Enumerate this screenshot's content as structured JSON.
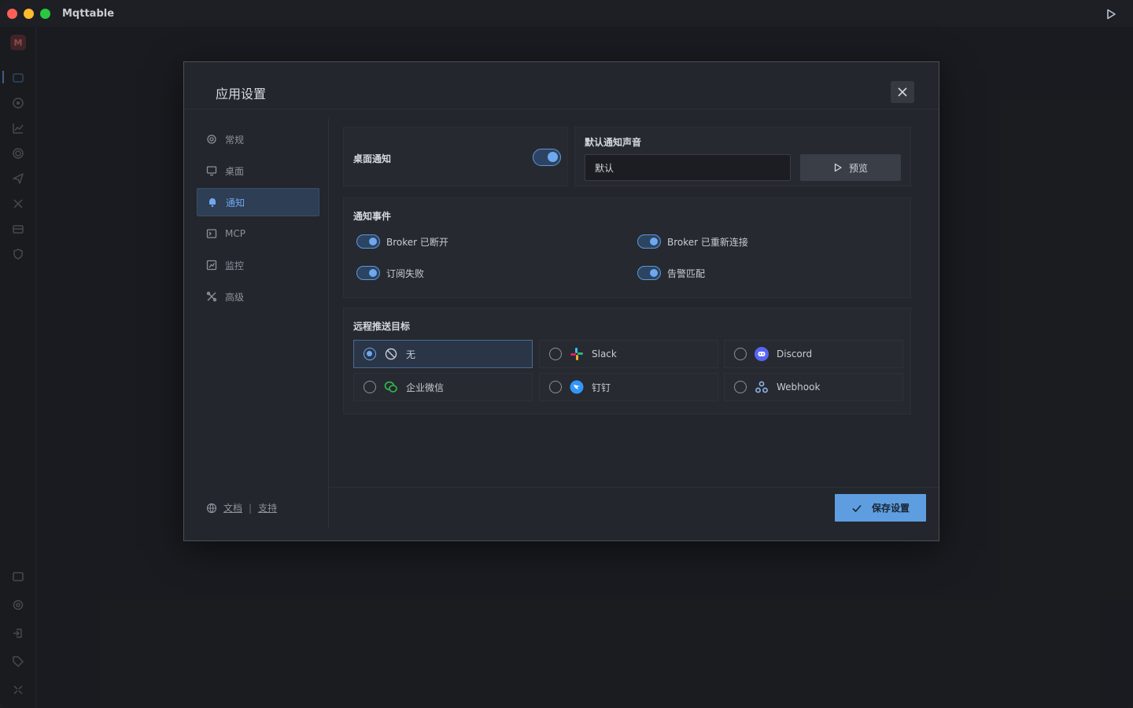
{
  "app": {
    "title": "Mqttable"
  },
  "dialog": {
    "title": "应用设置",
    "close_label": "close"
  },
  "sidebar": {
    "items": [
      {
        "label": "常规",
        "icon": "gear-icon"
      },
      {
        "label": "桌面",
        "icon": "monitor-icon"
      },
      {
        "label": "通知",
        "icon": "bell-icon",
        "active": true
      },
      {
        "label": "MCP",
        "icon": "terminal-icon"
      },
      {
        "label": "监控",
        "icon": "chart-icon"
      },
      {
        "label": "高级",
        "icon": "tools-icon"
      }
    ],
    "footer": {
      "docs": "文档",
      "separator": "|",
      "support": "支持"
    }
  },
  "desktop_notification": {
    "label": "桌面通知",
    "enabled": true
  },
  "sound": {
    "label": "默认通知声音",
    "value": "默认",
    "preview_label": "预览"
  },
  "events": {
    "title": "通知事件",
    "items": [
      {
        "label": "Broker 已断开",
        "enabled": true
      },
      {
        "label": "Broker 已重新连接",
        "enabled": true
      },
      {
        "label": "订阅失败",
        "enabled": true
      },
      {
        "label": "告警匹配",
        "enabled": true
      }
    ]
  },
  "targets": {
    "title": "远程推送目标",
    "items": [
      {
        "label": "无",
        "icon": "ban-icon",
        "selected": true
      },
      {
        "label": "Slack",
        "icon": "slack-icon",
        "selected": false
      },
      {
        "label": "Discord",
        "icon": "discord-icon",
        "selected": false
      },
      {
        "label": "企业微信",
        "icon": "wecom-icon",
        "selected": false
      },
      {
        "label": "钉钉",
        "icon": "dingtalk-icon",
        "selected": false
      },
      {
        "label": "Webhook",
        "icon": "webhook-icon",
        "selected": false
      }
    ]
  },
  "footer": {
    "save_label": "保存设置"
  },
  "colors": {
    "accent": "#6fa8ee",
    "save_button": "#5e9ee0",
    "background": "#1d1f24",
    "dialog": "#23262d"
  }
}
